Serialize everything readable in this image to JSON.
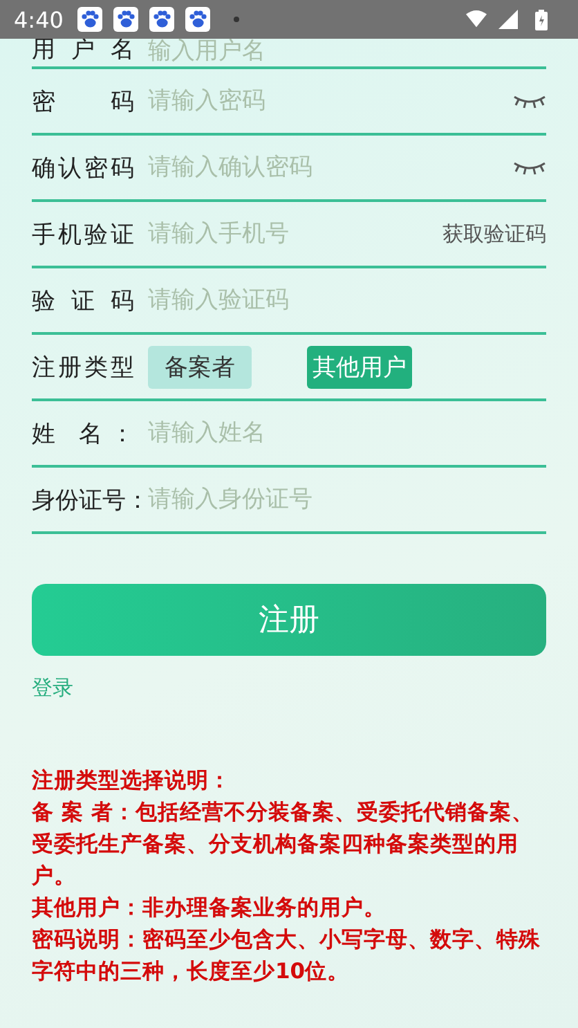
{
  "status_bar": {
    "time": "4:40"
  },
  "fields": [
    {
      "kind": "input",
      "label": "用 户 名",
      "placeholder": "输入用户名"
    },
    {
      "kind": "password",
      "label": "密 码",
      "placeholder": "请输入密码"
    },
    {
      "kind": "password",
      "label": "确认密码",
      "placeholder": "请输入确认密码"
    },
    {
      "kind": "sms",
      "label": "手机验证",
      "placeholder": "请输入手机号",
      "action": "获取验证码"
    },
    {
      "kind": "input",
      "label": "验 证 码",
      "placeholder": "请输入验证码"
    },
    {
      "kind": "choice",
      "label": "注册类型",
      "options": [
        {
          "label": "备案者",
          "selected": false
        },
        {
          "label": "其他用户",
          "selected": true
        }
      ]
    },
    {
      "kind": "input",
      "label": "姓 名：",
      "placeholder": "请输入姓名"
    },
    {
      "kind": "input",
      "label": "身份证号：",
      "placeholder": "请输入身份证号"
    }
  ],
  "submit": "注册",
  "login_link": "登录",
  "notes": [
    "注册类型选择说明：",
    "备 案 者：包括经营不分装备案、受委托代销备案、受委托生产备案、分支机构备案四种备案类型的用户。",
    "其他用户：非办理备案业务的用户。",
    "密码说明：密码至少包含大、小写字母、数字、特殊字符中的三种，长度至少10位。"
  ]
}
